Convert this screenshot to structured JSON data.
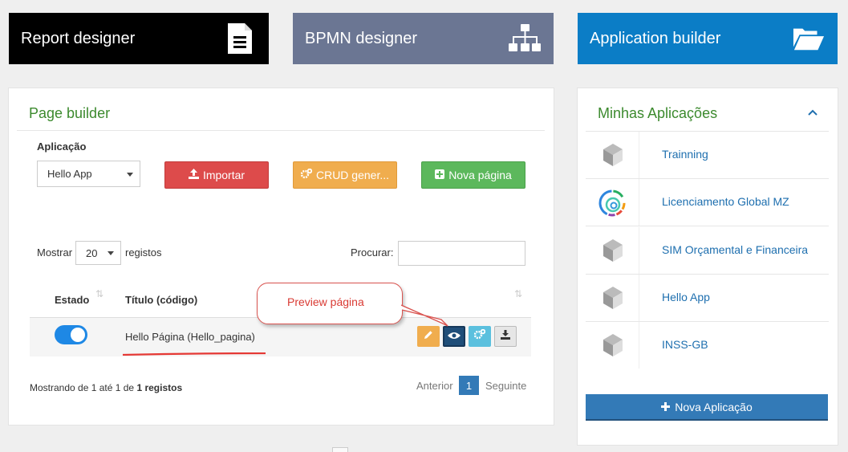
{
  "tiles": {
    "report": "Report designer",
    "bpmn": "BPMN designer",
    "app_builder": "Application builder"
  },
  "page_builder": {
    "title": "Page builder",
    "aplicacao_label": "Aplicação",
    "aplicacao_value": "Hello App",
    "import_label": "Importar",
    "crud_label": "CRUD gener...",
    "nova_pagina_label": "Nova página",
    "mostrar_label": "Mostrar",
    "page_size": "20",
    "registos_label": "registos",
    "procurar_label": "Procurar:",
    "search_value": "",
    "columns": {
      "estado": "Estado",
      "titulo": "Título (código)"
    },
    "rows": [
      {
        "titulo": "Hello Página (Hello_pagina)",
        "estado_on": true
      }
    ],
    "info_prefix": "Mostrando de 1 até 1 de ",
    "info_bold": "1 registos",
    "pagination": {
      "prev": "Anterior",
      "current": "1",
      "next": "Seguinte"
    }
  },
  "annotation": {
    "callout_text": "Preview página",
    "color": "#d9534f"
  },
  "minhas_aplicacoes": {
    "title": "Minhas Aplicações",
    "items": [
      {
        "name": "Trainning",
        "icon": "cube-icon"
      },
      {
        "name": "Licenciamento Global MZ",
        "icon": "spiral-logo-icon"
      },
      {
        "name": "SIM Orçamental e Financeira",
        "icon": "cube-icon"
      },
      {
        "name": "Hello App",
        "icon": "cube-icon"
      },
      {
        "name": "INSS-GB",
        "icon": "cube-icon"
      }
    ],
    "nova_aplicacao_label": "Nova Aplicação"
  },
  "colors": {
    "report_tile": "#000000",
    "bpmn_tile": "#6b7693",
    "app_tile": "#0b7dc6",
    "title_green": "#3c8a2e",
    "primary": "#337ab7"
  }
}
